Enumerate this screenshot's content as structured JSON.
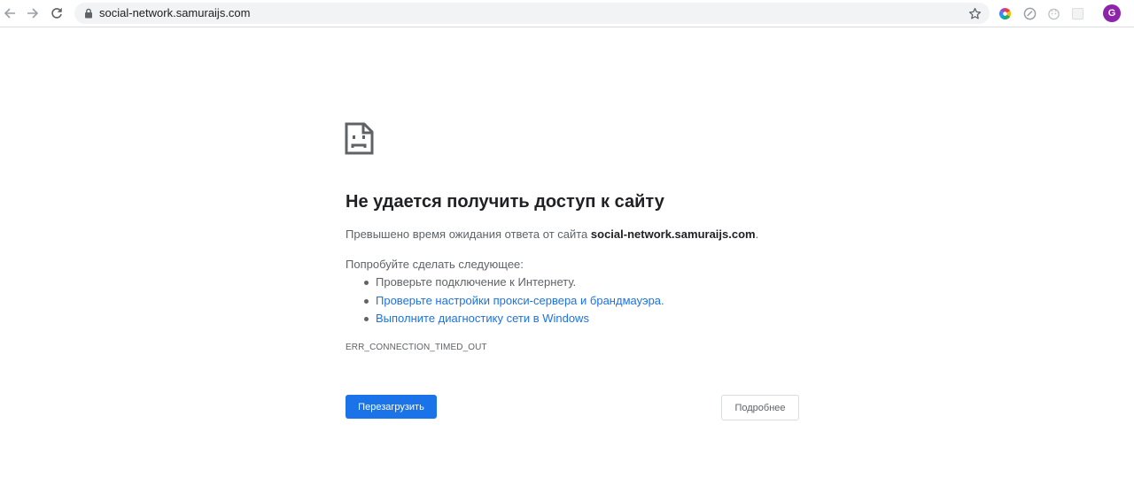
{
  "browser": {
    "back_icon": "arrow-left-icon",
    "forward_icon": "arrow-right-icon",
    "reload_icon": "reload-icon",
    "url": "social-network.samuraijs.com",
    "profile_initial": "G",
    "colors": {
      "toolbar_bg": "#ffffff",
      "omnibox_bg": "#f1f3f4",
      "avatar": "#8e24aa"
    }
  },
  "error_page": {
    "icon": "sad-page-icon",
    "heading": "Не удается получить доступ к сайту",
    "description_prefix": "Превышено время ожидания ответа от сайта ",
    "description_site": "social-network.samuraijs.com",
    "description_suffix": ".",
    "suggestions_title": "Попробуйте сделать следующее:",
    "suggestions": [
      {
        "label": "Проверьте подключение к Интернету.",
        "is_link": false
      },
      {
        "label": "Проверьте настройки прокси-сервера и брандмауэра.",
        "is_link": true
      },
      {
        "label": "Выполните диагностику сети в Windows",
        "is_link": true
      }
    ],
    "error_code": "ERR_CONNECTION_TIMED_OUT",
    "reload_button": "Перезагрузить",
    "details_button": "Подробнее",
    "colors": {
      "primary": "#1a73e8",
      "text": "#202124",
      "secondary_text": "#5f6368"
    }
  }
}
